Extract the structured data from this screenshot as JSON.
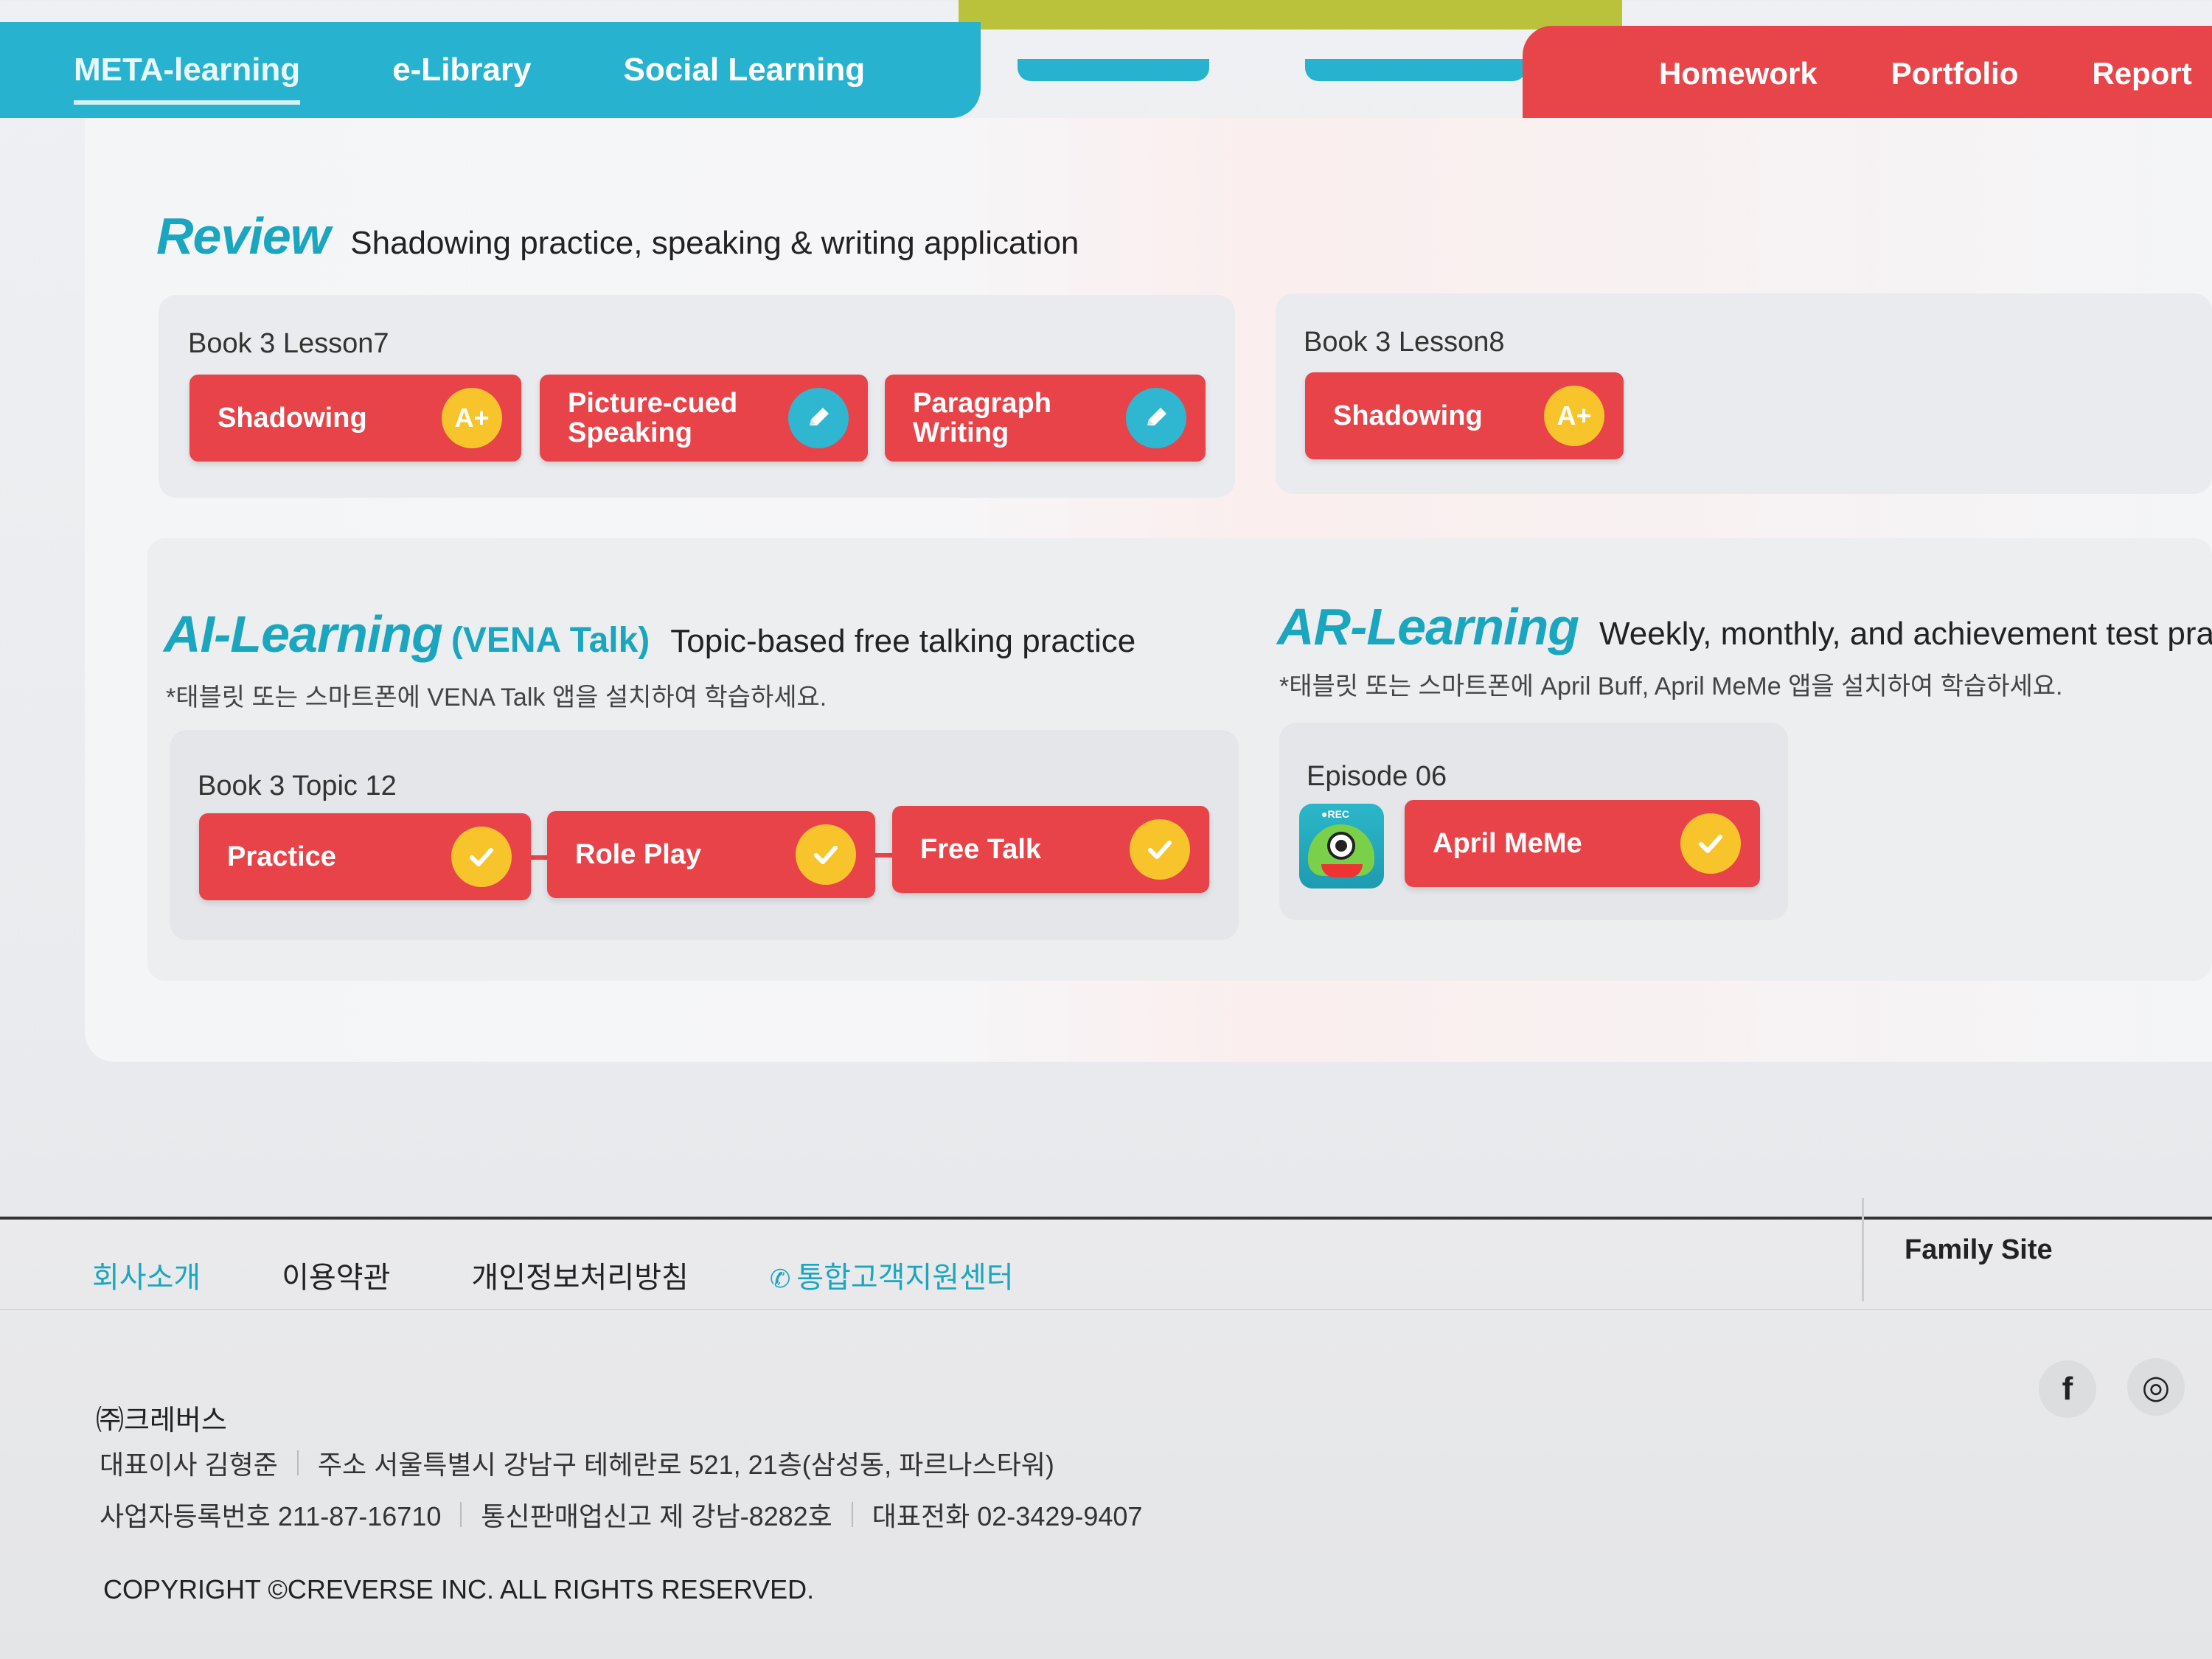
{
  "nav": {
    "left_items": [
      "META-learning",
      "e-Library",
      "Social Learning"
    ],
    "right_items": [
      "Homework",
      "Portfolio",
      "Report"
    ]
  },
  "review": {
    "title": "Review",
    "description": "Shadowing practice, speaking & writing application",
    "cards": [
      {
        "label": "Book 3 Lesson7",
        "buttons": [
          {
            "label": "Shadowing",
            "badge": "A+"
          },
          {
            "label_line1": "Picture-cued",
            "label_line2": "Speaking",
            "badge": "pencil-icon"
          },
          {
            "label_line1": "Paragraph",
            "label_line2": "Writing",
            "badge": "pencil-icon"
          }
        ]
      },
      {
        "label": "Book 3 Lesson8",
        "buttons": [
          {
            "label": "Shadowing",
            "badge": "A+"
          }
        ]
      }
    ]
  },
  "ai_learning": {
    "title": "AI-Learning",
    "subtitle": "(VENA Talk)",
    "description": "Topic-based free talking practice",
    "note": "*태블릿 또는 스마트폰에 VENA Talk 앱을 설치하여 학습하세요.",
    "card_label": "Book 3 Topic 12",
    "buttons": [
      "Practice",
      "Role Play",
      "Free Talk"
    ]
  },
  "ar_learning": {
    "title": "AR-Learning",
    "description": "Weekly, monthly, and achievement test prac",
    "note": "*태블릿 또는 스마트폰에 April Buff, April MeMe 앱을 설치하여 학습하세요.",
    "card_label": "Episode 06",
    "app_icon_text": "●REC",
    "button": "April MeMe"
  },
  "footer": {
    "links": [
      "회사소개",
      "이용약관",
      "개인정보처리방침",
      "통합고객지원센터"
    ],
    "family_site": "Family Site",
    "social": [
      "f",
      "◎"
    ],
    "company": "㈜크레버스",
    "ceo": "대표이사 김형준",
    "address": "주소 서울특별시 강남구 테헤란로 521, 21층(삼성동, 파르나스타워)",
    "business_no": "사업자등록번호 211-87-16710",
    "mail_order": "통신판매업신고 제 강남-8282호",
    "phone": "대표전화 02-3429-9407",
    "copyright": "COPYRIGHT ©CREVERSE INC. ALL RIGHTS RESERVED."
  },
  "colors": {
    "teal": "#27b3cf",
    "red": "#e8454a",
    "yellow": "#f7c52b"
  }
}
